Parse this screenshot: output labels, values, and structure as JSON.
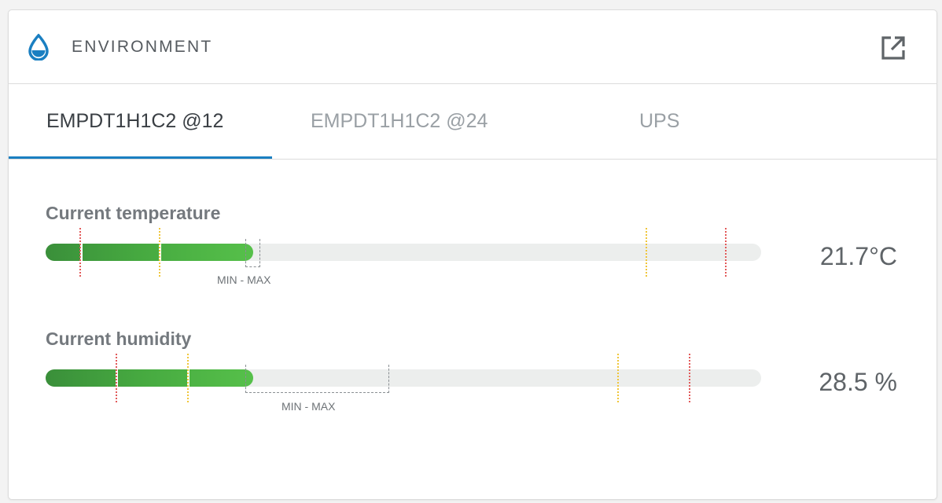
{
  "panel": {
    "title": "ENVIRONMENT",
    "icon": "water-drop-icon",
    "open_icon": "open-external-icon",
    "accent_color": "#1a7fc1"
  },
  "tabs": [
    {
      "label": "EMPDT1H1C2 @12",
      "active": true
    },
    {
      "label": "EMPDT1H1C2 @24",
      "active": false
    },
    {
      "label": "UPS",
      "active": false
    }
  ],
  "metrics": {
    "temperature": {
      "label": "Current temperature",
      "value": "21.7°C",
      "minmax_label": "MIN - MAX"
    },
    "humidity": {
      "label": "Current humidity",
      "value": "28.5 %",
      "minmax_label": "MIN - MAX"
    }
  },
  "colors": {
    "fill_green": "#46a940",
    "threshold_red": "#e25a5a",
    "threshold_yellow": "#f0c63a",
    "track_gray": "#eceeed"
  }
}
